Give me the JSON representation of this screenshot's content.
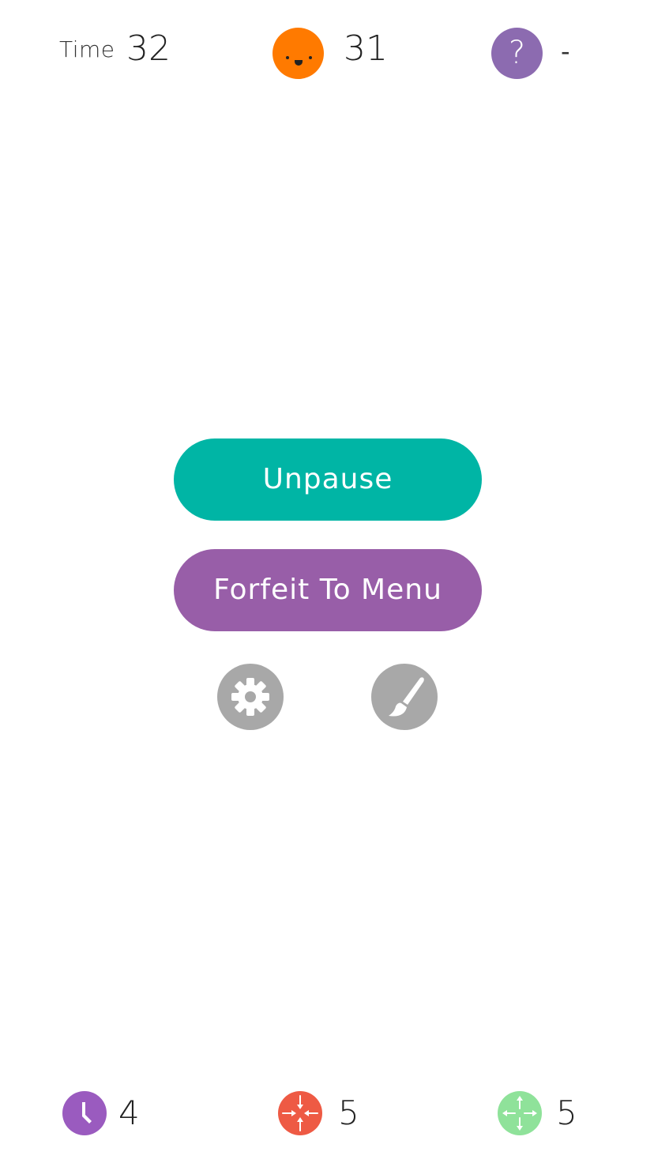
{
  "hud": {
    "time_label": "Time",
    "time_value": "32",
    "score_value": "31",
    "help_symbol": "?",
    "unknown_value": "-",
    "icons": {
      "score": "orange-face-icon",
      "help": "question-mark-icon"
    }
  },
  "pause_menu": {
    "unpause_label": "Unpause",
    "forfeit_label": "Forfeit To Menu",
    "settings_icon": "gear-icon",
    "theme_icon": "paint-brush-icon"
  },
  "powerups": [
    {
      "icon": "clock-icon",
      "count": "4",
      "color": "#9a5bbf"
    },
    {
      "icon": "shrink-arrows-icon",
      "count": "5",
      "color": "#ee5a44"
    },
    {
      "icon": "expand-arrows-icon",
      "count": "5",
      "color": "#8fe29a"
    }
  ],
  "colors": {
    "teal": "#00b5a5",
    "purple": "#985ea8",
    "orange": "#ff7a00",
    "help_purple": "#8c6bb0",
    "gray": "#a8a8a8"
  }
}
